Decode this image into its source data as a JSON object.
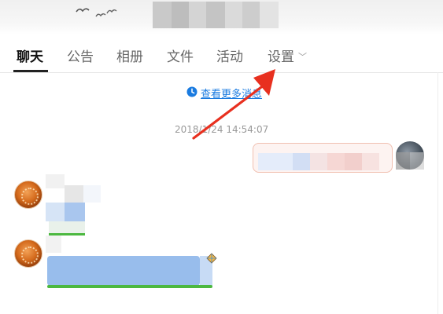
{
  "tabs": [
    {
      "label": "聊天",
      "active": true
    },
    {
      "label": "公告",
      "active": false
    },
    {
      "label": "相册",
      "active": false
    },
    {
      "label": "文件",
      "active": false
    },
    {
      "label": "活动",
      "active": false
    },
    {
      "label": "设置",
      "active": false,
      "has_dropdown": true
    }
  ],
  "chat": {
    "more_messages_link": "查看更多消息",
    "timestamp": "2018/1/24 14:54:07"
  },
  "icons": {
    "more_messages": "clock-icon",
    "settings_dropdown": "chevron-down-icon",
    "annotation": "red-arrow-icon"
  },
  "colors": {
    "link": "#1a7be0",
    "annotation_arrow": "#e8301f",
    "active_tab_underline": "#222222"
  }
}
